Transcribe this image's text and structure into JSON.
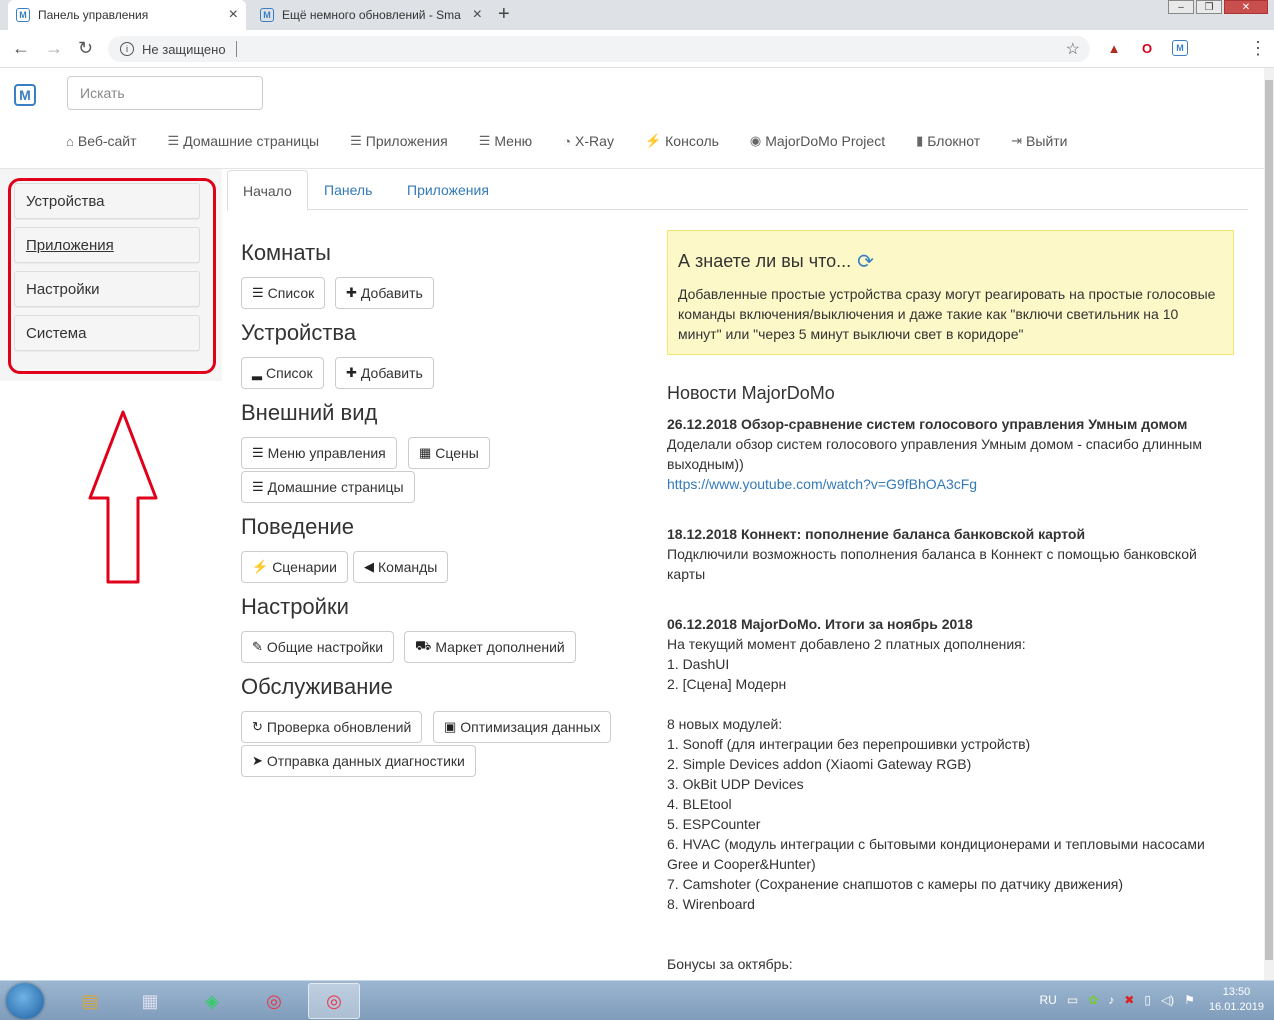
{
  "browser": {
    "tabs": [
      {
        "title": "Панель управления",
        "active": true
      },
      {
        "title": "Ещё немного обновлений - Sma",
        "active": false
      }
    ],
    "address": {
      "security_label": "Не защищено"
    }
  },
  "header": {
    "search_placeholder": "Искать",
    "nav": [
      {
        "label": "Веб-сайт",
        "icon": "home-icon"
      },
      {
        "label": "Домашние страницы",
        "icon": "list-icon"
      },
      {
        "label": "Приложения",
        "icon": "list-icon"
      },
      {
        "label": "Меню",
        "icon": "list-icon"
      },
      {
        "label": "X-Ray",
        "icon": "gauge-icon"
      },
      {
        "label": "Консоль",
        "icon": "bolt-icon"
      },
      {
        "label": "MajorDoMo Project",
        "icon": "globe-icon"
      },
      {
        "label": "Блокнот",
        "icon": "book-icon"
      },
      {
        "label": "Выйти",
        "icon": "logout-icon"
      }
    ]
  },
  "sidebar": {
    "items": [
      {
        "label": "Устройства"
      },
      {
        "label": "Приложения"
      },
      {
        "label": "Настройки"
      },
      {
        "label": "Система"
      }
    ]
  },
  "tabs": [
    "Начало",
    "Панель",
    "Приложения"
  ],
  "sections": [
    {
      "title": "Комнаты",
      "buttons": [
        "Список",
        "Добавить"
      ]
    },
    {
      "title": "Устройства",
      "buttons": [
        "Список",
        "Добавить"
      ]
    },
    {
      "title": "Внешний вид",
      "buttons": [
        "Меню управления",
        "Сцены",
        "Домашние страницы"
      ]
    },
    {
      "title": "Поведение",
      "buttons": [
        "Сценарии",
        "Команды"
      ]
    },
    {
      "title": "Настройки",
      "buttons": [
        "Общие настройки",
        "Маркет дополнений"
      ]
    },
    {
      "title": "Обслуживание",
      "buttons": [
        "Проверка обновлений",
        "Оптимизация данных",
        "Отправка данных диагностики"
      ]
    }
  ],
  "tip": {
    "title": "А знаете ли вы что...",
    "text": "Добавленные простые устройства сразу могут реагировать на простые голосовые команды включения/выключения и даже такие как \"включи светильник на 10 минут\" или \"через 5 минут выключи свет в коридоре\""
  },
  "news": {
    "title": "Новости MajorDoMo",
    "items": [
      {
        "headline": "26.12.2018 Обзор-сравнение систем голосового управления Умным домом",
        "body": "Доделали обзор систем голосового управления Умным домом - спасибо длинным выходным))",
        "link": "https://www.youtube.com/watch?v=G9fBhOA3cFg"
      },
      {
        "headline": "18.12.2018 Коннект: пополнение баланса банковской картой",
        "body": "Подключили возможность пополнения баланса в Коннект с помощью банковской карты"
      },
      {
        "headline": "06.12.2018 MajorDoMo. Итоги за ноябрь 2018",
        "lines": [
          "На текущий момент добавлено 2 платных дополнения:",
          "1. DashUI",
          "2. [Сцена] Модерн",
          "",
          "8 новых модулей:",
          "1. Sonoff (для интеграции без перепрошивки устройств)",
          "2. Simple Devices addon (Xiaomi Gateway RGB)",
          "3. OkBit UDP Devices",
          "4. BLEtool",
          "5. ESPCounter",
          "6. HVAC (модуль интеграции с бытовыми кондиционерами и тепловыми насосами Gree и Cooper&Hunter)",
          "7. Camshoter (Сохранение снапшотов с камеры по датчику движения)",
          "8. Wirenboard",
          "",
          "",
          "Бонусы за октябрь:"
        ]
      }
    ]
  },
  "taskbar": {
    "lang": "RU",
    "time": "13:50",
    "date": "16.01.2019"
  }
}
